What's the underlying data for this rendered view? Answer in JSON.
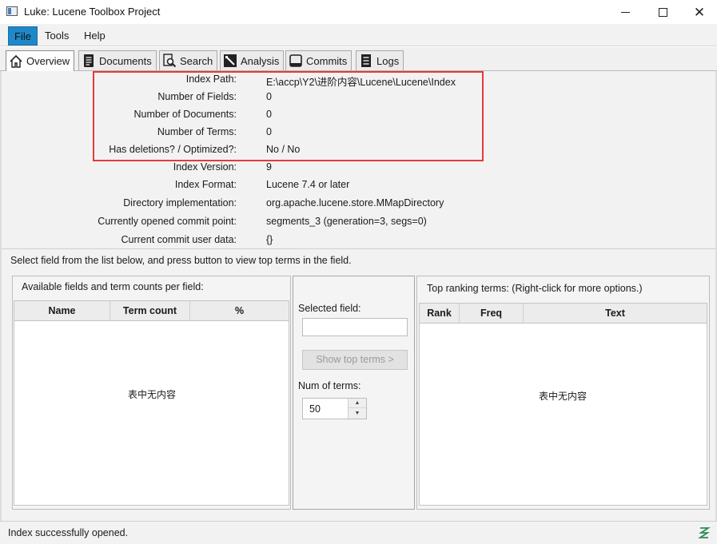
{
  "window": {
    "title": "Luke: Lucene Toolbox Project"
  },
  "menu": {
    "items": [
      "File",
      "Tools",
      "Help"
    ]
  },
  "tabs": [
    {
      "label": "Overview",
      "icon": "home-icon"
    },
    {
      "label": "Documents",
      "icon": "document-icon"
    },
    {
      "label": "Search",
      "icon": "search-icon"
    },
    {
      "label": "Analysis",
      "icon": "analysis-icon"
    },
    {
      "label": "Commits",
      "icon": "commits-icon"
    },
    {
      "label": "Logs",
      "icon": "logs-icon"
    }
  ],
  "overview": {
    "rows": [
      {
        "label": "Index Path:",
        "value": "E:\\accp\\Y2\\进阶内容\\Lucene\\Lucene\\Index"
      },
      {
        "label": "Number of Fields:",
        "value": "0"
      },
      {
        "label": "Number of Documents:",
        "value": "0"
      },
      {
        "label": "Number of Terms:",
        "value": "0"
      },
      {
        "label": "Has deletions? / Optimized?:",
        "value": "No / No"
      },
      {
        "label": "Index Version:",
        "value": "9"
      },
      {
        "label": "Index Format:",
        "value": "Lucene 7.4 or later"
      },
      {
        "label": "Directory implementation:",
        "value": "org.apache.lucene.store.MMapDirectory"
      },
      {
        "label": "Currently opened commit point:",
        "value": "segments_3 (generation=3, segs=0)"
      },
      {
        "label": "Current commit user data:",
        "value": "{}"
      }
    ],
    "instruction": "Select field from the list below, and press button to view top terms in the field."
  },
  "fields_panel": {
    "title": "Available fields and term counts per field:",
    "columns": [
      "Name",
      "Term count",
      "%"
    ],
    "empty_message": "表中无内容"
  },
  "middle_panel": {
    "selected_field_label": "Selected field:",
    "selected_field_value": "",
    "show_button": "Show top terms >",
    "num_terms_label": "Num of terms:",
    "num_terms_value": "50"
  },
  "terms_panel": {
    "title": "Top ranking terms: (Right-click for more options.)",
    "columns": [
      "Rank",
      "Freq",
      "Text"
    ],
    "empty_message": "表中无内容"
  },
  "status": {
    "text": "Index successfully opened."
  },
  "colors": {
    "highlight": "#e53a3a",
    "menu_active": "#1e88c9"
  }
}
